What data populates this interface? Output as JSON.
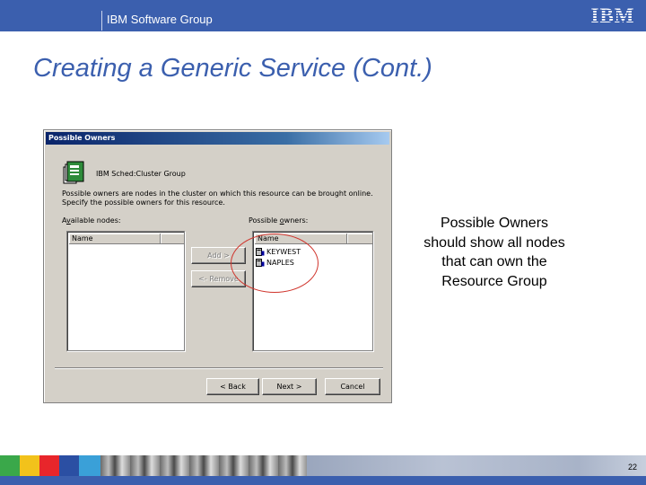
{
  "header": {
    "group_label": "IBM Software Group",
    "logo_text": "IBM",
    "brand_color": "#3b5fae"
  },
  "slide": {
    "title": "Creating a Generic Service (Cont.)",
    "callout_lines": [
      "Possible Owners",
      "should show all nodes",
      "that can own the",
      "Resource Group"
    ],
    "page_number": "22"
  },
  "dialog": {
    "title": "Possible Owners",
    "group_icon": "cluster-group-icon",
    "group_name": "IBM Sched:Cluster Group",
    "description_line1": "Possible owners are nodes in the cluster on which this resource can be brought online.",
    "description_line2": "Specify the possible owners for this resource.",
    "available_label_prefix": "A",
    "available_label_accel": "v",
    "available_label_suffix": "ailable nodes:",
    "owners_label_prefix": "Possible ",
    "owners_label_accel": "o",
    "owners_label_suffix": "wners:",
    "available_column": "Name",
    "owners_column": "Name",
    "available_nodes": [],
    "possible_owners": [
      "KEYWEST",
      "NAPLES"
    ],
    "add_label": "Add >",
    "remove_label": "<- Remove",
    "back_label": "< Back",
    "next_label": "Next >",
    "cancel_label": "Cancel",
    "highlight_color": "#d0342c"
  }
}
